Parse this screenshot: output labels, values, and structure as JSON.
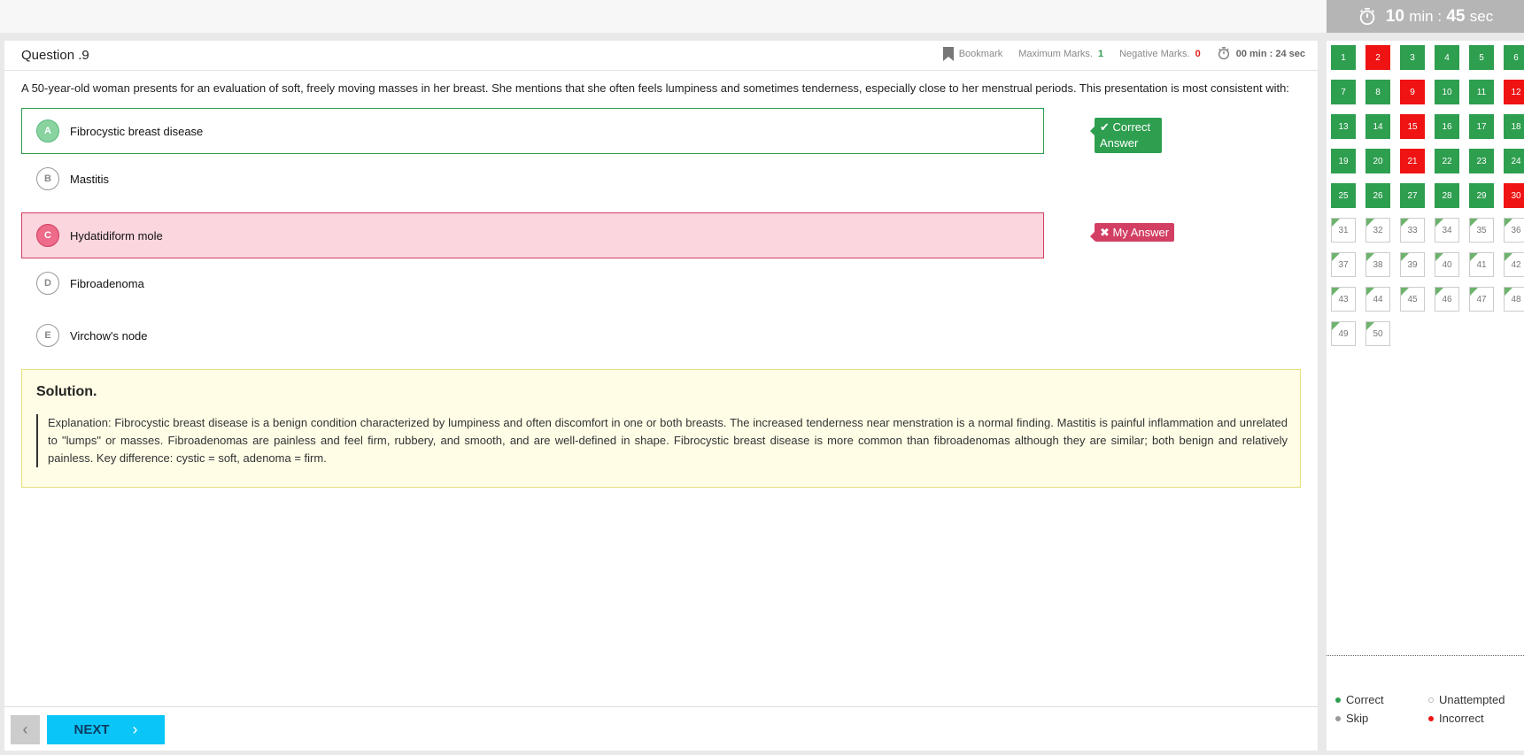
{
  "timer": {
    "value": "10 min : 45 sec",
    "min": "10",
    "min_label": "min :",
    "sec": "45",
    "sec_label": "sec"
  },
  "question": {
    "title": "Question .9",
    "bookmark_label": "Bookmark",
    "max_marks_label": "Maximum Marks.",
    "max_marks": "1",
    "neg_marks_label": "Negative Marks.",
    "neg_marks": "0",
    "time_spent": "00 min : 24 sec",
    "text": "A 50-year-old woman presents for an evaluation of soft, freely moving masses in her breast. She mentions that she often feels lumpiness and sometimes tenderness, especially close to her menstrual periods. This presentation is most consistent with:"
  },
  "options": [
    {
      "letter": "A",
      "text": "Fibrocystic breast disease",
      "state": "correct"
    },
    {
      "letter": "B",
      "text": "Mastitis",
      "state": "none"
    },
    {
      "letter": "C",
      "text": "Hydatidiform mole",
      "state": "wrong"
    },
    {
      "letter": "D",
      "text": "Fibroadenoma",
      "state": "none"
    },
    {
      "letter": "E",
      "text": "Virchow's node",
      "state": "none"
    }
  ],
  "tags": {
    "correct": "Correct Answer",
    "mine": "My Answer"
  },
  "solution": {
    "title": "Solution.",
    "text": "Explanation: Fibrocystic breast disease is a benign condition characterized by lumpiness and often discomfort in one or both breasts. The increased tenderness near menstration is a normal finding. Mastitis is painful inflammation and unrelated to \"lumps\" or masses. Fibroadenomas are painless and feel firm, rubbery, and smooth, and are well-defined in shape. Fibrocystic breast disease is more common than fibroadenomas although they are similar; both benign and relatively painless. Key difference: cystic = soft, adenoma = firm."
  },
  "nav": {
    "next_label": "NEXT"
  },
  "palette": {
    "incorrect": [
      2,
      9,
      12,
      15,
      21,
      30
    ],
    "answered_through": 30,
    "total": 50
  },
  "legend": {
    "correct": "Correct",
    "unattempted": "Unattempted",
    "skip": "Skip",
    "incorrect": "Incorrect"
  },
  "colors": {
    "correct": "#2e9e4f",
    "incorrect": "#ef1313",
    "accent": "#0ac5f7",
    "wrong_bg": "#fbd6de"
  }
}
